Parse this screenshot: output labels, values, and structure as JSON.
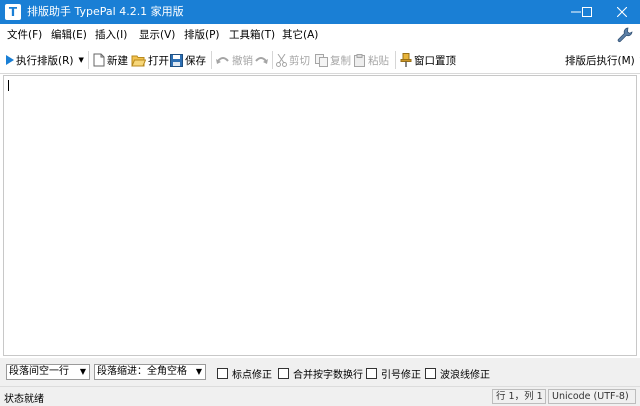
{
  "window": {
    "icon_letter": "T",
    "title": "排版助手 TypePal 4.2.1 家用版"
  },
  "menu": {
    "items": [
      "文件(F)",
      "编辑(E)",
      "插入(I)",
      "显示(V)",
      "排版(P)",
      "工具箱(T)",
      "其它(A)"
    ]
  },
  "toolbar": {
    "run_format": "执行排版(R)",
    "new": "新建",
    "open": "打开",
    "save": "保存",
    "undo": "撤销",
    "cut": "剪切",
    "copy": "复制",
    "paste": "粘贴",
    "pin_window": "窗口置顶",
    "after_format": "排版后执行(M)"
  },
  "options": {
    "paragraph_spacing": "段落间空一行",
    "paragraph_indent": "段落缩进：全角空格",
    "punct_fix": "标点修正",
    "merge_wrap": "合并按字数换行",
    "quote_fix": "引号修正",
    "tilde_fix": "波浪线修正"
  },
  "status": {
    "text": "状态就绪",
    "position": "行 1，列 1",
    "encoding": "Unicode (UTF-8)"
  },
  "colors": {
    "titlebar": "#1a7fd5",
    "accent_icon": "#1a7fd5"
  }
}
